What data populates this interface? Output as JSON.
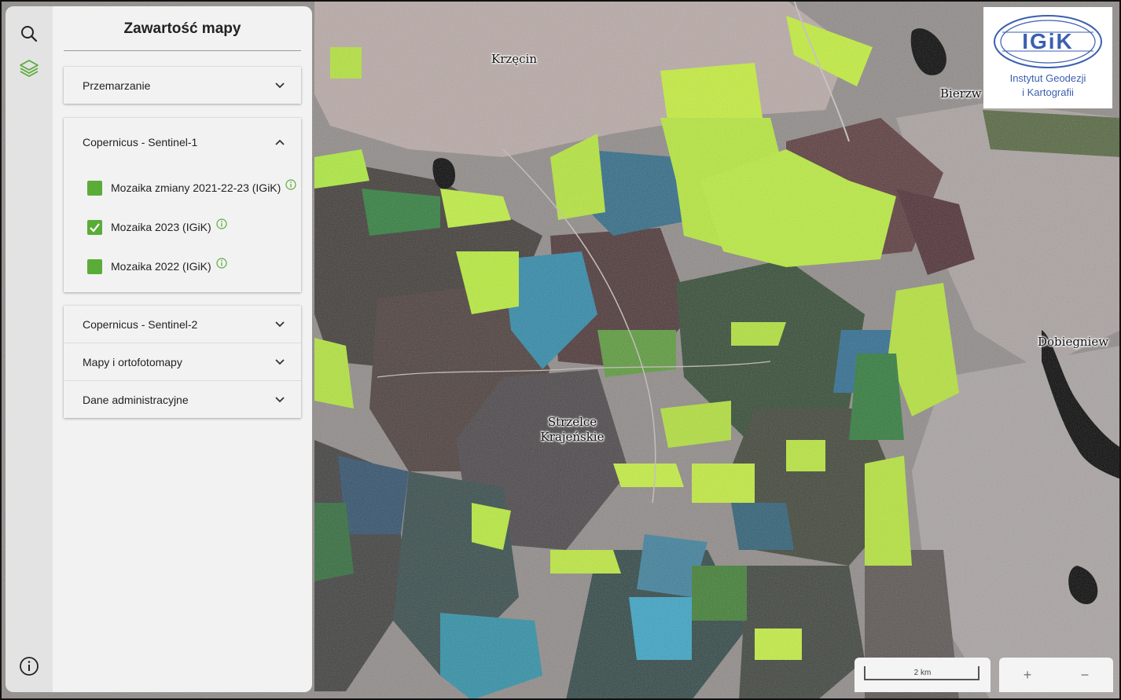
{
  "panel": {
    "title": "Zawartość mapy",
    "sections": [
      {
        "label": "Przemarzanie",
        "expanded": false
      },
      {
        "label": "Copernicus - Sentinel-1",
        "expanded": true,
        "layers": [
          {
            "label": "Mozaika zmiany 2021-22-23 (IGiK)",
            "checked": false
          },
          {
            "label": "Mozaika 2023 (IGiK)",
            "checked": true
          },
          {
            "label": "Mozaika 2022 (IGiK)",
            "checked": false
          }
        ]
      },
      {
        "label": "Copernicus - Sentinel-2",
        "expanded": false
      },
      {
        "label": "Mapy i ortofotomapy",
        "expanded": false
      },
      {
        "label": "Dane administracyjne",
        "expanded": false
      }
    ]
  },
  "rail": {
    "icons": [
      "search-icon",
      "layers-icon",
      "info-icon"
    ]
  },
  "map": {
    "places": [
      {
        "name": "Krzęcin"
      },
      {
        "name": "Bierzw"
      },
      {
        "name": "Dobiegniew"
      },
      {
        "name": "Strzelce Krajeńskie",
        "line1": "Strzelce",
        "line2": "Krajeńskie"
      }
    ]
  },
  "logo": {
    "acronym": "IGiK",
    "line1": "Instytut Geodezji",
    "line2": "i Kartografii"
  },
  "scale": {
    "label": "2 km"
  },
  "zoom": {
    "in_label": "+",
    "out_label": "−"
  },
  "colors": {
    "accent": "#5aac38",
    "logo_blue": "#3b5fb0"
  }
}
